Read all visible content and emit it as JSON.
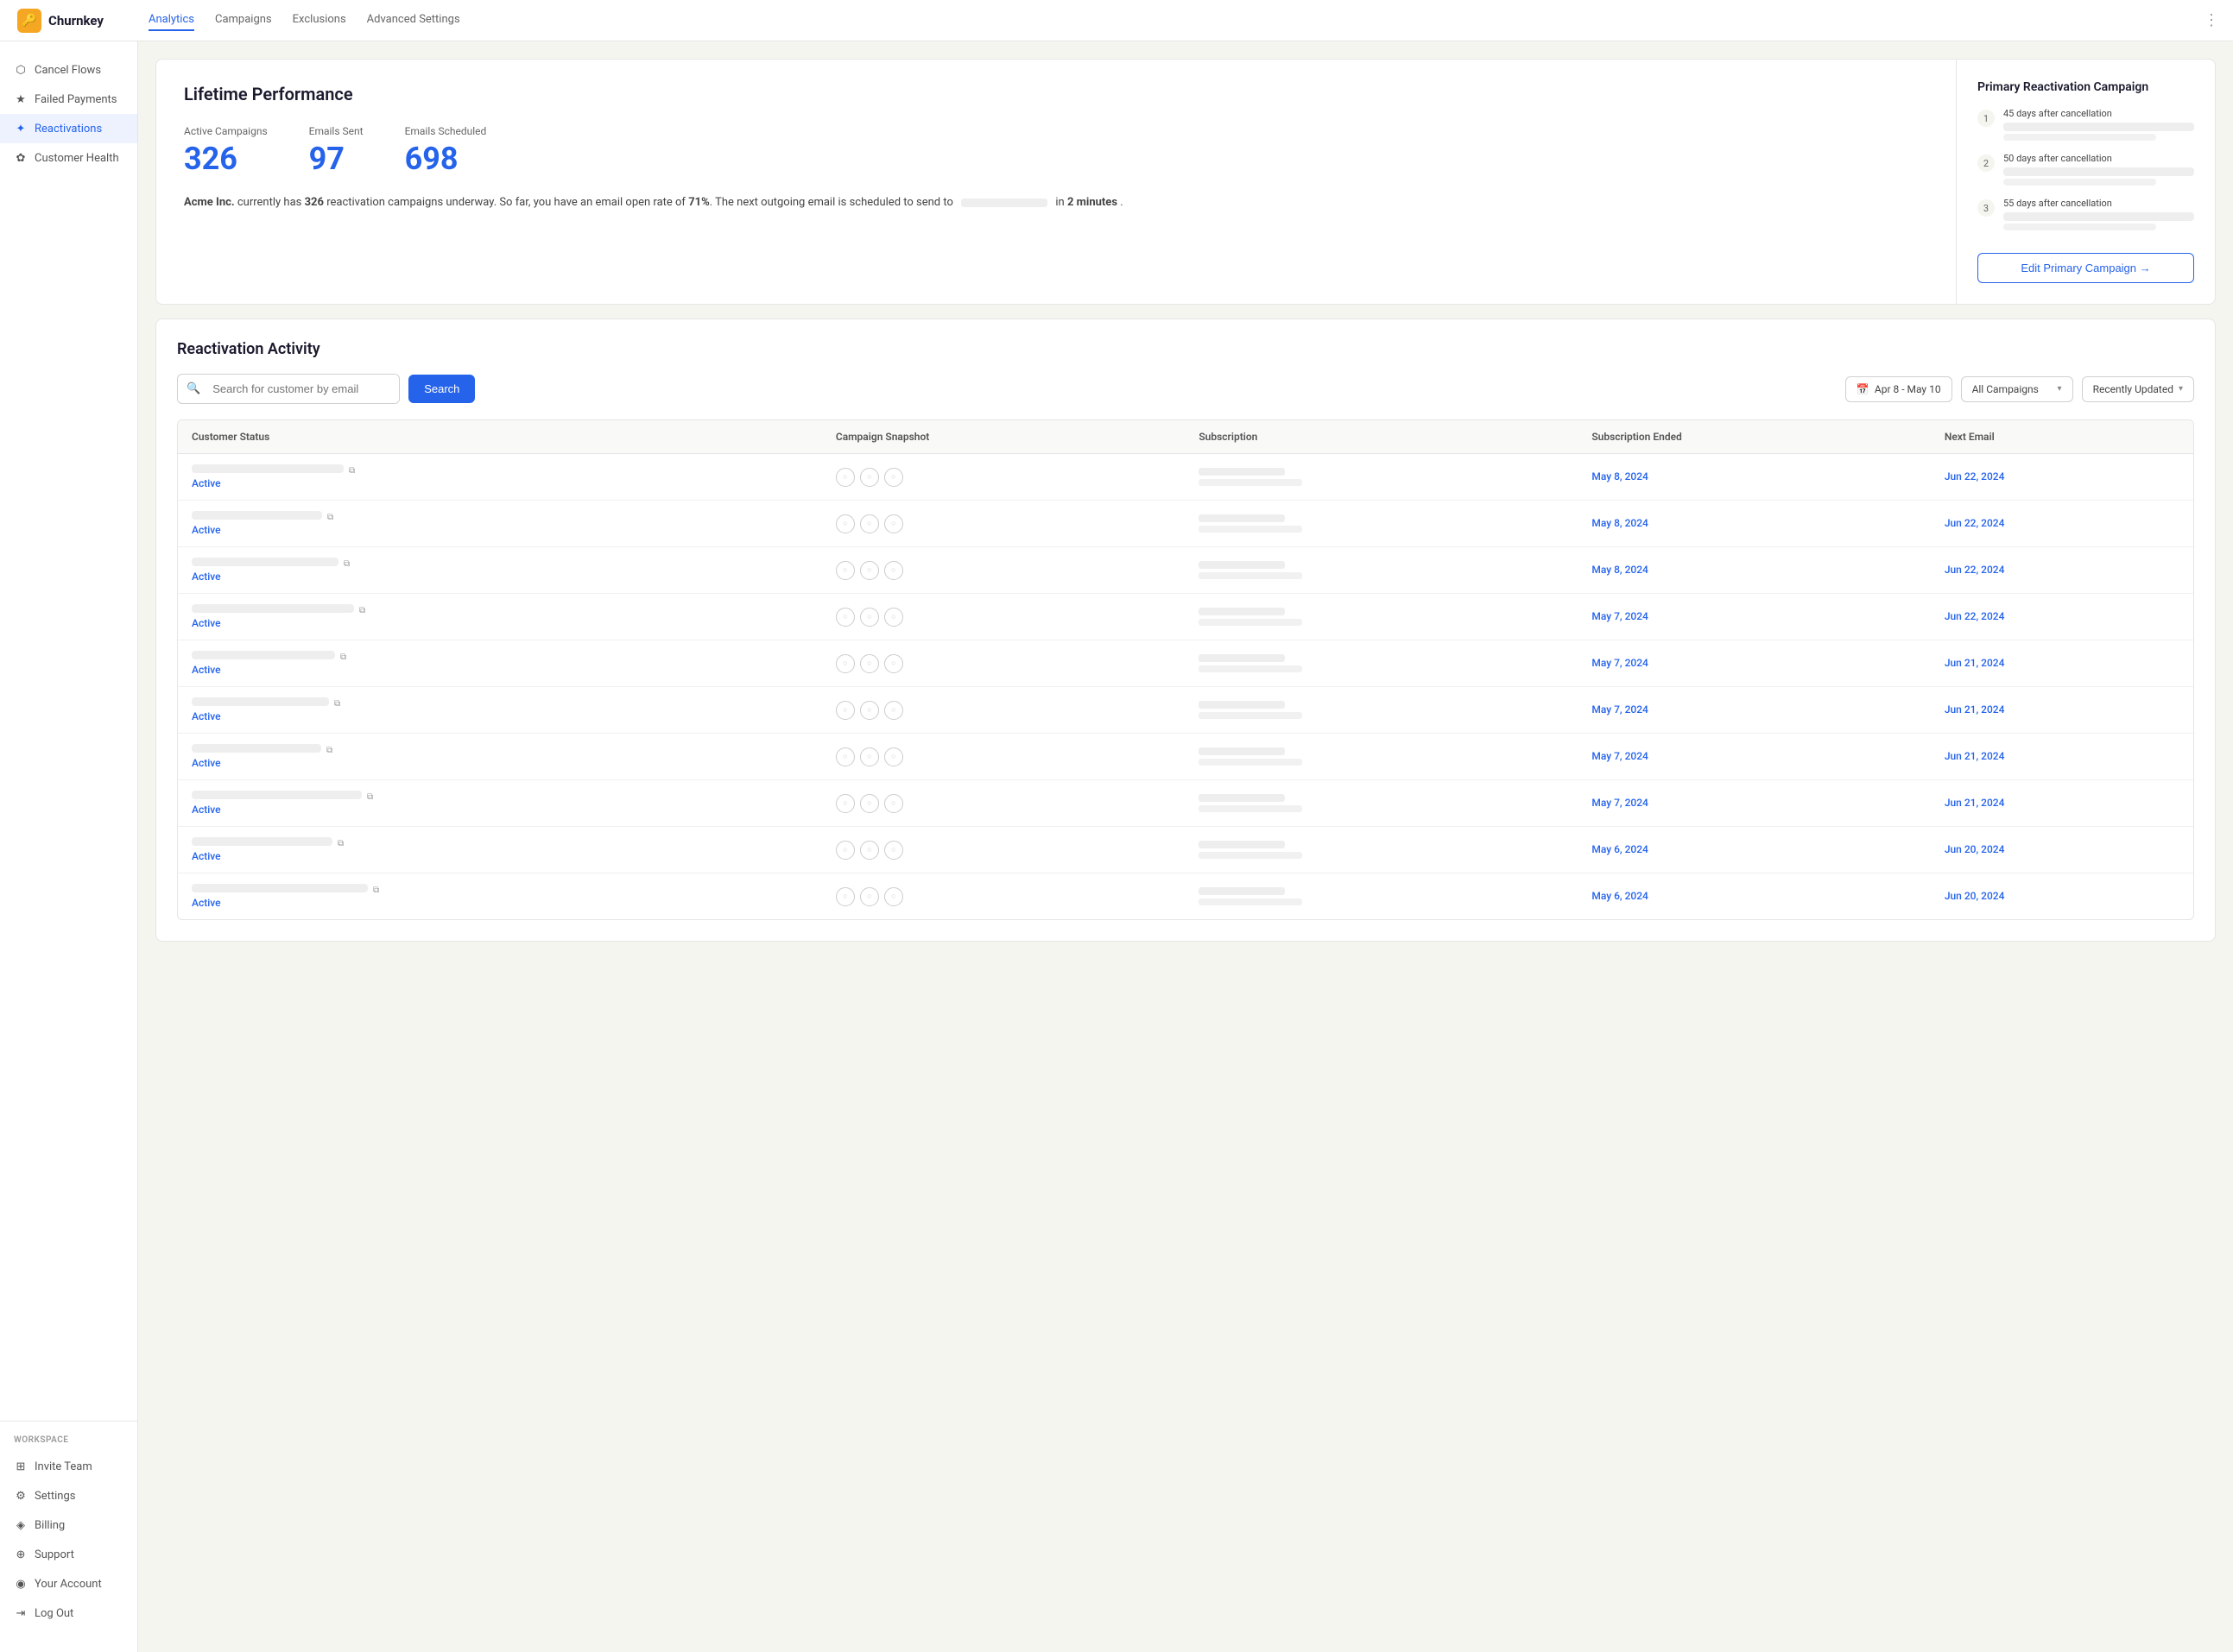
{
  "brand": {
    "name": "Churnkey",
    "logo_emoji": "🔑"
  },
  "top_nav": {
    "links": [
      {
        "label": "Analytics",
        "active": true
      },
      {
        "label": "Campaigns",
        "active": false
      },
      {
        "label": "Exclusions",
        "active": false
      },
      {
        "label": "Advanced Settings",
        "active": false
      }
    ]
  },
  "sidebar": {
    "items": [
      {
        "id": "cancel-flows",
        "label": "Cancel Flows",
        "icon": "⬡"
      },
      {
        "id": "failed-payments",
        "label": "Failed Payments",
        "icon": "★"
      },
      {
        "id": "reactivations",
        "label": "Reactivations",
        "icon": "✦",
        "active": true
      },
      {
        "id": "customer-health",
        "label": "Customer Health",
        "icon": "✿"
      }
    ],
    "workspace_label": "WORKSPACE",
    "bottom_items": [
      {
        "id": "invite-team",
        "label": "Invite Team",
        "icon": "⊞"
      },
      {
        "id": "settings",
        "label": "Settings",
        "icon": "⚙"
      },
      {
        "id": "billing",
        "label": "Billing",
        "icon": "◈"
      },
      {
        "id": "support",
        "label": "Support",
        "icon": "⊕"
      },
      {
        "id": "your-account",
        "label": "Your Account",
        "icon": "◉"
      },
      {
        "id": "log-out",
        "label": "Log Out",
        "icon": "⇥"
      }
    ]
  },
  "lifetime_performance": {
    "title": "Lifetime Performance",
    "stats": [
      {
        "label": "Active Campaigns",
        "value": "326"
      },
      {
        "label": "Emails Sent",
        "value": "97"
      },
      {
        "label": "Emails Scheduled",
        "value": "698"
      }
    ],
    "description_1": "Acme Inc.",
    "description_2": " currently has ",
    "description_3": "326",
    "description_4": " reactivation campaigns underway. So far, you have an email open rate of ",
    "description_5": "71%",
    "description_6": ". The next outgoing email is scheduled to send to",
    "description_7": "in ",
    "description_8": "2 minutes",
    "description_9": " ."
  },
  "primary_campaign": {
    "title": "Primary Reactivation Campaign",
    "items": [
      {
        "num": "1",
        "days": "45 days after cancellation"
      },
      {
        "num": "2",
        "days": "50 days after cancellation"
      },
      {
        "num": "3",
        "days": "55 days after cancellation"
      }
    ],
    "edit_button": "Edit Primary Campaign →"
  },
  "reactivation_activity": {
    "title": "Reactivation Activity",
    "search_placeholder": "Search for customer by email",
    "search_button": "Search",
    "date_filter": "Apr 8 - May 10",
    "campaign_filter": "All Campaigns",
    "sort_filter": "Recently Updated",
    "table_headers": [
      "Customer Status",
      "Campaign Snapshot",
      "Subscription",
      "Subscription Ended",
      "Next Email"
    ],
    "rows": [
      {
        "status": "Active",
        "sub_ended": "May 8, 2024",
        "next_email": "Jun 22, 2024"
      },
      {
        "status": "Active",
        "sub_ended": "May 8, 2024",
        "next_email": "Jun 22, 2024"
      },
      {
        "status": "Active",
        "sub_ended": "May 8, 2024",
        "next_email": "Jun 22, 2024"
      },
      {
        "status": "Active",
        "sub_ended": "May 7, 2024",
        "next_email": "Jun 22, 2024"
      },
      {
        "status": "Active",
        "sub_ended": "May 7, 2024",
        "next_email": "Jun 21, 2024"
      },
      {
        "status": "Active",
        "sub_ended": "May 7, 2024",
        "next_email": "Jun 21, 2024"
      },
      {
        "status": "Active",
        "sub_ended": "May 7, 2024",
        "next_email": "Jun 21, 2024"
      },
      {
        "status": "Active",
        "sub_ended": "May 7, 2024",
        "next_email": "Jun 21, 2024"
      },
      {
        "status": "Active",
        "sub_ended": "May 6, 2024",
        "next_email": "Jun 20, 2024"
      },
      {
        "status": "Active",
        "sub_ended": "May 6, 2024",
        "next_email": "Jun 20, 2024"
      }
    ]
  }
}
